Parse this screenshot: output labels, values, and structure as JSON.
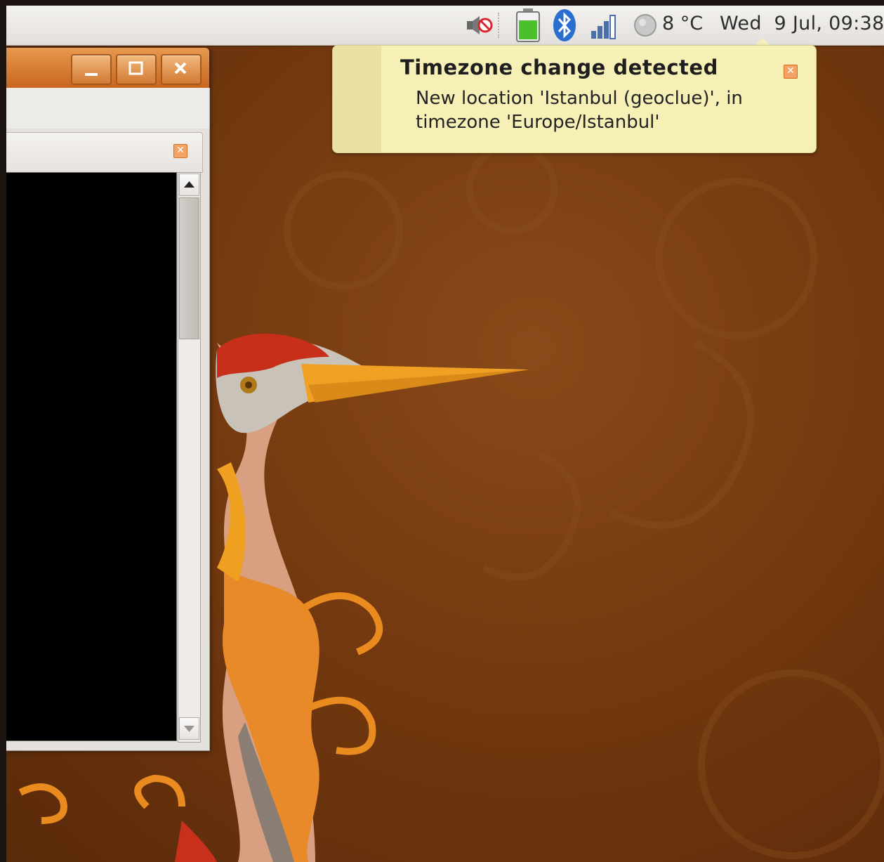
{
  "top_panel": {
    "weather_temp": "8 °C",
    "clock": "Wed  9 Jul, 09:38",
    "icons": [
      "volume-muted-icon",
      "battery-icon",
      "bluetooth-icon",
      "network-signal-icon",
      "weather-icon"
    ]
  },
  "notification": {
    "title": "Timezone change detected",
    "body_line1": "New location 'Istanbul (geoclue)', in",
    "body_line2": "timezone 'Europe/Istanbul'",
    "close_symbol": "✕"
  },
  "window": {
    "minimize_symbol": "–",
    "maximize_symbol": "□",
    "close_symbol": "✕",
    "pane_close_symbol": "✕"
  },
  "colors": {
    "panel": "#e9e6e2",
    "notification_bg": "#f6f0b6",
    "titlebar": "#d97a33",
    "wallpaper": "#7a3d12"
  }
}
